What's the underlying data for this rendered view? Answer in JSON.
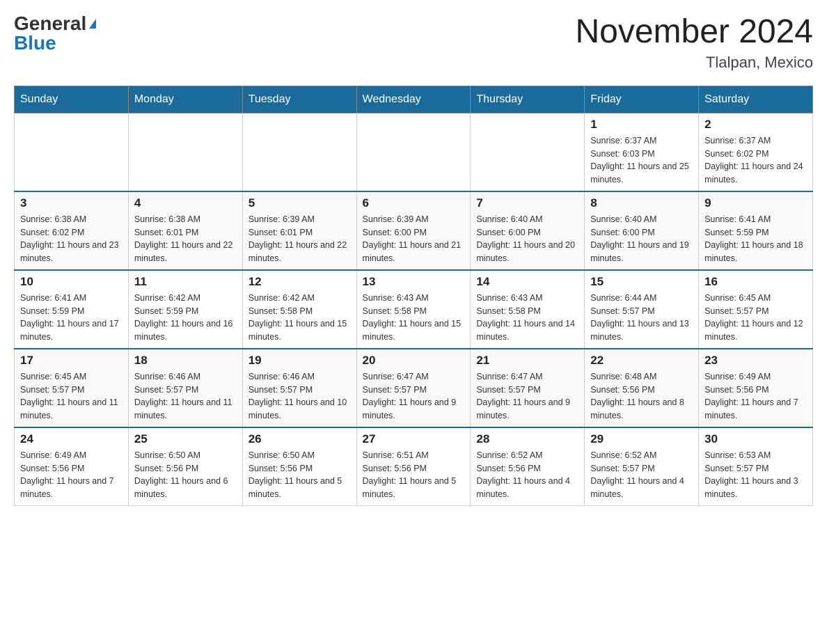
{
  "header": {
    "logo_general": "General",
    "logo_blue": "Blue",
    "month_year": "November 2024",
    "location": "Tlalpan, Mexico"
  },
  "days_of_week": [
    "Sunday",
    "Monday",
    "Tuesday",
    "Wednesday",
    "Thursday",
    "Friday",
    "Saturday"
  ],
  "weeks": [
    [
      {
        "day": "",
        "info": ""
      },
      {
        "day": "",
        "info": ""
      },
      {
        "day": "",
        "info": ""
      },
      {
        "day": "",
        "info": ""
      },
      {
        "day": "",
        "info": ""
      },
      {
        "day": "1",
        "info": "Sunrise: 6:37 AM\nSunset: 6:03 PM\nDaylight: 11 hours and 25 minutes."
      },
      {
        "day": "2",
        "info": "Sunrise: 6:37 AM\nSunset: 6:02 PM\nDaylight: 11 hours and 24 minutes."
      }
    ],
    [
      {
        "day": "3",
        "info": "Sunrise: 6:38 AM\nSunset: 6:02 PM\nDaylight: 11 hours and 23 minutes."
      },
      {
        "day": "4",
        "info": "Sunrise: 6:38 AM\nSunset: 6:01 PM\nDaylight: 11 hours and 22 minutes."
      },
      {
        "day": "5",
        "info": "Sunrise: 6:39 AM\nSunset: 6:01 PM\nDaylight: 11 hours and 22 minutes."
      },
      {
        "day": "6",
        "info": "Sunrise: 6:39 AM\nSunset: 6:00 PM\nDaylight: 11 hours and 21 minutes."
      },
      {
        "day": "7",
        "info": "Sunrise: 6:40 AM\nSunset: 6:00 PM\nDaylight: 11 hours and 20 minutes."
      },
      {
        "day": "8",
        "info": "Sunrise: 6:40 AM\nSunset: 6:00 PM\nDaylight: 11 hours and 19 minutes."
      },
      {
        "day": "9",
        "info": "Sunrise: 6:41 AM\nSunset: 5:59 PM\nDaylight: 11 hours and 18 minutes."
      }
    ],
    [
      {
        "day": "10",
        "info": "Sunrise: 6:41 AM\nSunset: 5:59 PM\nDaylight: 11 hours and 17 minutes."
      },
      {
        "day": "11",
        "info": "Sunrise: 6:42 AM\nSunset: 5:59 PM\nDaylight: 11 hours and 16 minutes."
      },
      {
        "day": "12",
        "info": "Sunrise: 6:42 AM\nSunset: 5:58 PM\nDaylight: 11 hours and 15 minutes."
      },
      {
        "day": "13",
        "info": "Sunrise: 6:43 AM\nSunset: 5:58 PM\nDaylight: 11 hours and 15 minutes."
      },
      {
        "day": "14",
        "info": "Sunrise: 6:43 AM\nSunset: 5:58 PM\nDaylight: 11 hours and 14 minutes."
      },
      {
        "day": "15",
        "info": "Sunrise: 6:44 AM\nSunset: 5:57 PM\nDaylight: 11 hours and 13 minutes."
      },
      {
        "day": "16",
        "info": "Sunrise: 6:45 AM\nSunset: 5:57 PM\nDaylight: 11 hours and 12 minutes."
      }
    ],
    [
      {
        "day": "17",
        "info": "Sunrise: 6:45 AM\nSunset: 5:57 PM\nDaylight: 11 hours and 11 minutes."
      },
      {
        "day": "18",
        "info": "Sunrise: 6:46 AM\nSunset: 5:57 PM\nDaylight: 11 hours and 11 minutes."
      },
      {
        "day": "19",
        "info": "Sunrise: 6:46 AM\nSunset: 5:57 PM\nDaylight: 11 hours and 10 minutes."
      },
      {
        "day": "20",
        "info": "Sunrise: 6:47 AM\nSunset: 5:57 PM\nDaylight: 11 hours and 9 minutes."
      },
      {
        "day": "21",
        "info": "Sunrise: 6:47 AM\nSunset: 5:57 PM\nDaylight: 11 hours and 9 minutes."
      },
      {
        "day": "22",
        "info": "Sunrise: 6:48 AM\nSunset: 5:56 PM\nDaylight: 11 hours and 8 minutes."
      },
      {
        "day": "23",
        "info": "Sunrise: 6:49 AM\nSunset: 5:56 PM\nDaylight: 11 hours and 7 minutes."
      }
    ],
    [
      {
        "day": "24",
        "info": "Sunrise: 6:49 AM\nSunset: 5:56 PM\nDaylight: 11 hours and 7 minutes."
      },
      {
        "day": "25",
        "info": "Sunrise: 6:50 AM\nSunset: 5:56 PM\nDaylight: 11 hours and 6 minutes."
      },
      {
        "day": "26",
        "info": "Sunrise: 6:50 AM\nSunset: 5:56 PM\nDaylight: 11 hours and 5 minutes."
      },
      {
        "day": "27",
        "info": "Sunrise: 6:51 AM\nSunset: 5:56 PM\nDaylight: 11 hours and 5 minutes."
      },
      {
        "day": "28",
        "info": "Sunrise: 6:52 AM\nSunset: 5:56 PM\nDaylight: 11 hours and 4 minutes."
      },
      {
        "day": "29",
        "info": "Sunrise: 6:52 AM\nSunset: 5:57 PM\nDaylight: 11 hours and 4 minutes."
      },
      {
        "day": "30",
        "info": "Sunrise: 6:53 AM\nSunset: 5:57 PM\nDaylight: 11 hours and 3 minutes."
      }
    ]
  ]
}
